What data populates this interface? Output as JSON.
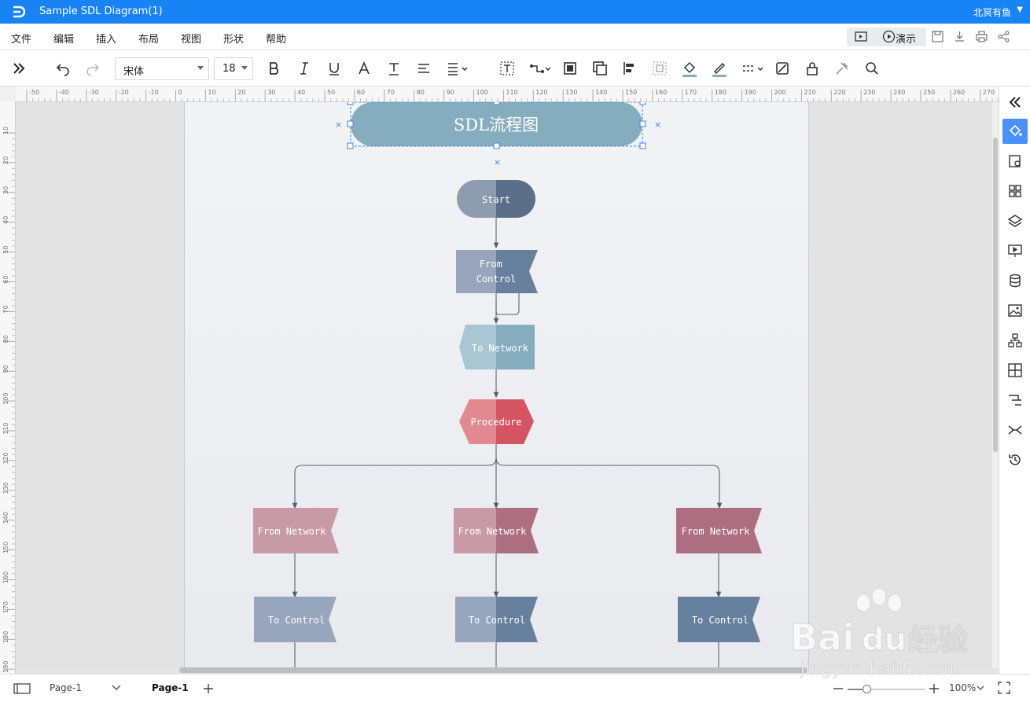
{
  "app": {
    "title": "Sample SDL Diagram(1)",
    "user": "北冥有鱼"
  },
  "menu": {
    "items": [
      "文件",
      "编辑",
      "插入",
      "布局",
      "视图",
      "形状",
      "帮助"
    ],
    "present_label": "演示"
  },
  "toolbar": {
    "font_family": "宋体",
    "font_size": "18"
  },
  "rulers": {
    "horizontal": [
      "-50",
      "-40",
      "-30",
      "-20",
      "-10",
      "0",
      "10",
      "20",
      "30",
      "40",
      "50",
      "60",
      "70",
      "80",
      "90",
      "100",
      "110",
      "120",
      "130",
      "140",
      "150",
      "160",
      "170",
      "180",
      "190",
      "200",
      "210",
      "220",
      "230",
      "240",
      "250",
      "260",
      "270"
    ],
    "vertical": [
      "10",
      "20",
      "30",
      "40",
      "50",
      "60",
      "70",
      "80",
      "90",
      "100",
      "110",
      "120",
      "130",
      "140",
      "150",
      "160",
      "170",
      "180",
      "190"
    ]
  },
  "diagram": {
    "title": "SDL流程图",
    "nodes": {
      "start": "Start",
      "from_control": "From Control",
      "to_network": "To Network",
      "procedure": "Procedure",
      "from_network_1": "From Network",
      "from_network_2": "From Network",
      "from_network_3": "From Network",
      "to_control_1": "To Control",
      "to_control_2": "To Control",
      "to_control_3": "To Control"
    },
    "colors": {
      "title_fill": "#86adbe",
      "start_light": "#8d9cae",
      "start_dark": "#5b6e8a",
      "control_light": "#97a6bc",
      "control_dark": "#67809e",
      "network_light": "#a9c6d3",
      "network_dark": "#86adbe",
      "procedure_light": "#e28891",
      "procedure_dark": "#d45462",
      "from_net_light": "#c89aa5",
      "from_net_dark": "#ad6f80",
      "accent": "#1883f5"
    }
  },
  "status": {
    "page_selector": "Page-1",
    "active_page": "Page-1",
    "zoom": "100%"
  },
  "watermark": {
    "brand": "Bai",
    "brand2": "du",
    "brand3": "经验",
    "url": "jingyan.baidu.com"
  }
}
